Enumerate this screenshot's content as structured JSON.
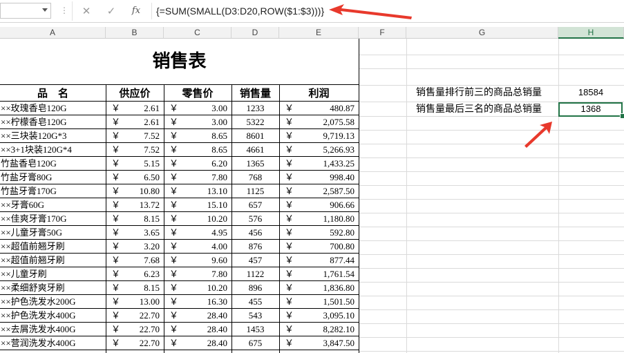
{
  "formula_bar": {
    "name_box": "",
    "cancel_icon": "✕",
    "enter_icon": "✓",
    "fx_label": "fx",
    "formula": "{=SUM(SMALL(D3:D20,ROW($1:$3)))}"
  },
  "columns": [
    "A",
    "B",
    "C",
    "D",
    "E",
    "F",
    "G",
    "H"
  ],
  "selected_column": "H",
  "sheet": {
    "title": "销售表",
    "headers": {
      "name": "品　名",
      "cost": "供应价",
      "retail": "零售价",
      "qty": "销售量",
      "profit": "利润"
    },
    "currency": "￥",
    "rows": [
      {
        "name": "××玫瑰香皂120G",
        "cost": "2.61",
        "retail": "3.00",
        "qty": "1233",
        "profit": "480.87"
      },
      {
        "name": "××柠檬香皂120G",
        "cost": "2.61",
        "retail": "3.00",
        "qty": "5322",
        "profit": "2,075.58"
      },
      {
        "name": "××三块装120G*3",
        "cost": "7.52",
        "retail": "8.65",
        "qty": "8601",
        "profit": "9,719.13"
      },
      {
        "name": "××3+1块装120G*4",
        "cost": "7.52",
        "retail": "8.65",
        "qty": "4661",
        "profit": "5,266.93"
      },
      {
        "name": "竹盐香皂120G",
        "cost": "5.15",
        "retail": "6.20",
        "qty": "1365",
        "profit": "1,433.25"
      },
      {
        "name": "竹盐牙膏80G",
        "cost": "6.50",
        "retail": "7.80",
        "qty": "768",
        "profit": "998.40"
      },
      {
        "name": "竹盐牙膏170G",
        "cost": "10.80",
        "retail": "13.10",
        "qty": "1125",
        "profit": "2,587.50"
      },
      {
        "name": "××牙膏60G",
        "cost": "13.72",
        "retail": "15.10",
        "qty": "657",
        "profit": "906.66"
      },
      {
        "name": "××佳爽牙膏170G",
        "cost": "8.15",
        "retail": "10.20",
        "qty": "576",
        "profit": "1,180.80"
      },
      {
        "name": "××儿童牙膏50G",
        "cost": "3.65",
        "retail": "4.95",
        "qty": "456",
        "profit": "592.80"
      },
      {
        "name": "××超值前翘牙刷",
        "cost": "3.20",
        "retail": "4.00",
        "qty": "876",
        "profit": "700.80"
      },
      {
        "name": "××超值前翘牙刷",
        "cost": "7.68",
        "retail": "9.60",
        "qty": "457",
        "profit": "877.44"
      },
      {
        "name": "××儿童牙刷",
        "cost": "6.23",
        "retail": "7.80",
        "qty": "1122",
        "profit": "1,761.54"
      },
      {
        "name": "××柔细舒爽牙刷",
        "cost": "8.15",
        "retail": "10.20",
        "qty": "896",
        "profit": "1,836.80"
      },
      {
        "name": "××护色洗发水200G",
        "cost": "13.00",
        "retail": "16.30",
        "qty": "455",
        "profit": "1,501.50"
      },
      {
        "name": "××护色洗发水400G",
        "cost": "22.70",
        "retail": "28.40",
        "qty": "543",
        "profit": "3,095.10"
      },
      {
        "name": "××去屑洗发水400G",
        "cost": "22.70",
        "retail": "28.40",
        "qty": "1453",
        "profit": "8,282.10"
      },
      {
        "name": "××营润洗发水400G",
        "cost": "22.70",
        "retail": "28.40",
        "qty": "675",
        "profit": "3,847.50"
      }
    ]
  },
  "summary": [
    {
      "label": "销售量排行前三的商品总销量",
      "value": "18584"
    },
    {
      "label": "销售量最后三名的商品总销量",
      "value": "1368"
    }
  ],
  "colors": {
    "accent": "#217346",
    "arrow": "#e8392c"
  }
}
